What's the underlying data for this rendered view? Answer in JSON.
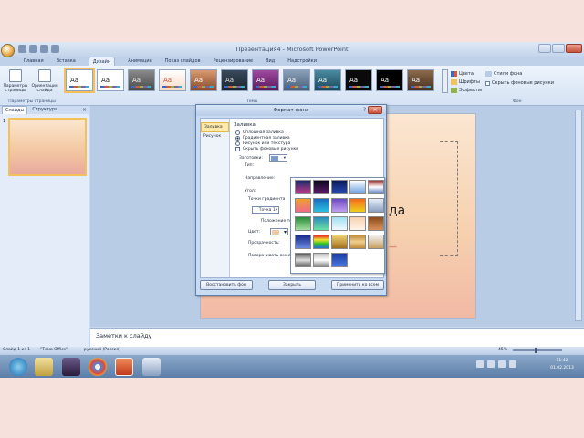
{
  "window": {
    "title": "Презентация4 - Microsoft PowerPoint"
  },
  "ribbon": {
    "tabs": [
      {
        "label": "Главная"
      },
      {
        "label": "Вставка"
      },
      {
        "label": "Дизайн",
        "active": true
      },
      {
        "label": "Анимация"
      },
      {
        "label": "Показ слайдов"
      },
      {
        "label": "Рецензирование"
      },
      {
        "label": "Вид"
      },
      {
        "label": "Надстройки"
      }
    ],
    "page_setup": {
      "btn1": "Параметры страницы",
      "btn2": "Ориентация слайда",
      "group_label": "Параметры страницы"
    },
    "themes": [
      "Aa",
      "Aa",
      "Aa",
      "Aa",
      "Aa",
      "Aa",
      "Aa",
      "Aa",
      "Aa",
      "Aa",
      "Aa",
      "Aa"
    ],
    "themes_label": "Темы",
    "theme_options": [
      "Цвета",
      "Шрифты",
      "Эффекты"
    ],
    "background": {
      "styles": "Стили фона",
      "hide": "Скрыть фоновые рисунки",
      "label": "Фон"
    }
  },
  "slides_pane": {
    "tab_slides": "Слайды",
    "tab_outline": "Структура",
    "close": "×",
    "thumb_number": "1"
  },
  "slide": {
    "text": "да",
    "mark": "—"
  },
  "notes": {
    "text": "Заметки к слайду"
  },
  "dialog": {
    "title": "Формат фона",
    "help": "?",
    "close": "×",
    "categories": [
      "Заливка",
      "Рисунок"
    ],
    "section": "Заливка",
    "radios": [
      {
        "label": "Сплошная заливка",
        "on": false
      },
      {
        "label": "Градиентная заливка",
        "on": true
      },
      {
        "label": "Рисунок или текстура",
        "on": false
      }
    ],
    "hide_bg": "Скрыть фоновые рисунки",
    "preset_label": "Заготовки:",
    "type_label": "Тип:",
    "direction_label": "Направление:",
    "angle_label": "Угол:",
    "stops_label": "Точки градиента",
    "stop_value": "Точка 1",
    "position_label": "Положение точки:",
    "color_label": "Цвет:",
    "transparency_label": "Прозрачность:",
    "rotate_label": "Поворачивать вместе с фигурой",
    "buttons": {
      "reset": "Восстановить фон",
      "close": "Закрыть",
      "apply_all": "Применить ко всем"
    }
  },
  "status": {
    "slide": "Слайд 1 из 1",
    "theme": "\"Тема Office\"",
    "lang": "русский (Россия)",
    "zoom": "45%"
  },
  "clock": {
    "time": "11:42",
    "date": "01.02.2013"
  },
  "colors": {
    "accent": "#f3c05a",
    "ribbon": "#d4e2f4",
    "taskbar": "#5c7ea8",
    "page_bg": "#f7e1dc"
  }
}
